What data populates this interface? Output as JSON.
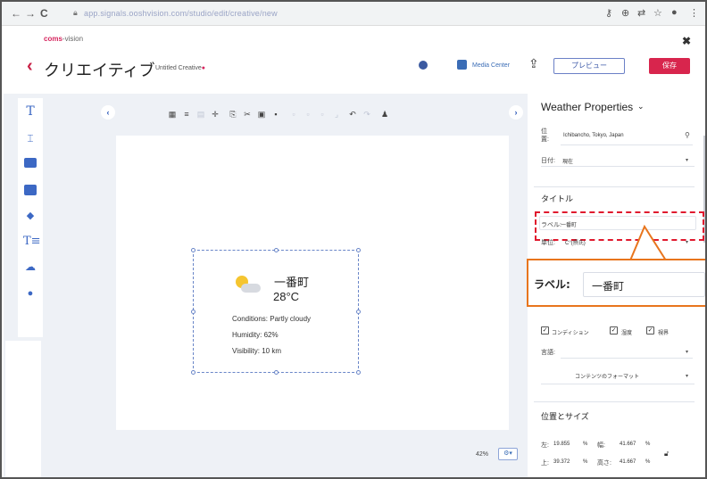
{
  "browser": {
    "url": "app.signals.ooshvision.com/studio/edit/creative/new",
    "nav_back": "←",
    "nav_forward": "→",
    "nav_reload": "C"
  },
  "app": {
    "logo_brand": "coms",
    "logo_rest": "-vision",
    "title": "クリエイティブ",
    "subtitle": "Untitled Creative",
    "subtitle_mark": "●",
    "media_center": "Media Center",
    "preview_label": "プレビュー",
    "save_label": "保存"
  },
  "canvas": {
    "location_name": "一番町",
    "temperature": "28°C",
    "conditions": "Conditions: Partly cloudy",
    "humidity": "Humidity: 62%",
    "visibility": "Visibility: 10 km",
    "zoom": "42%",
    "zoom_button": "⚙▾"
  },
  "panel": {
    "title": "Weather Properties",
    "location_label": "位置:",
    "location_value": "Ichibancho, Tokyo, Japan",
    "date_label": "日付:",
    "date_value": "現在",
    "title_section": "タイトル",
    "label_label": "ラベル:",
    "label_value": "一番町",
    "unit_label": "単位:",
    "unit_value": "C°(摂氏)",
    "checkbox_conditions": "コンディション",
    "checkbox_humidity": "湿度",
    "checkbox_visibility": "視界",
    "language_label": "言語:",
    "content_format": "コンテンツのフォーマット",
    "position_section": "位置とサイズ",
    "left_label": "左:",
    "left_value": "19.855",
    "top_label": "上:",
    "top_value": "39.372",
    "width_label": "幅:",
    "width_value": "41.667",
    "height_label": "高さ:",
    "height_value": "41.667",
    "percent": "%"
  },
  "callout": {
    "label": "ラベル:",
    "value": "一番町"
  },
  "colors": {
    "accent_red": "#d8254d",
    "accent_blue": "#3c68c4",
    "callout_orange": "#e8751d",
    "highlight_red": "#e0192e"
  }
}
